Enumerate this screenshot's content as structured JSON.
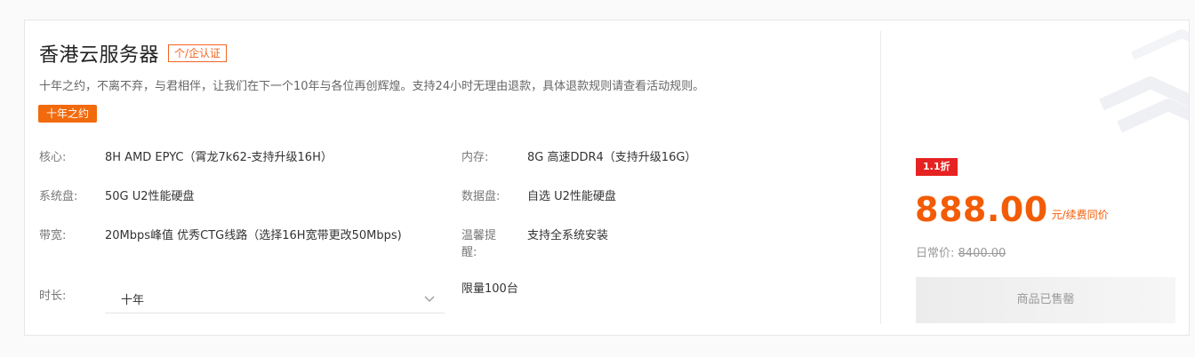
{
  "product": {
    "title": "香港云服务器",
    "auth_tag": "个/企认证",
    "description": "十年之约，不离不弃，与君相伴，让我们在下一个10年与各位再创辉煌。支持24小时无理由退款，具体退款规则请查看活动规则。",
    "promo_tag": "十年之约"
  },
  "specs": {
    "cpu": {
      "label": "核心:",
      "value": "8H AMD EPYC（霄龙7k62-支持升级16H）"
    },
    "memory": {
      "label": "内存:",
      "value": "8G 高速DDR4（支持升级16G）"
    },
    "system_disk": {
      "label": "系统盘:",
      "value": "50G U2性能硬盘"
    },
    "data_disk": {
      "label": "数据盘:",
      "value": "自选 U2性能硬盘"
    },
    "bandwidth": {
      "label": "带宽:",
      "value": "20Mbps峰值 优秀CTG线路（选择16H宽带更改50Mbps)"
    },
    "notice": {
      "label_line1": "温馨提",
      "label_line2": "醒:",
      "value": "支持全系统安装"
    },
    "duration": {
      "label": "时长:",
      "selected": "十年",
      "icon": "chevron-down-icon"
    },
    "limit": "限量100台"
  },
  "pricing": {
    "discount_badge": "1.1折",
    "price": "888.00",
    "price_unit": "元/续费同价",
    "original_label": "日常价:",
    "original_price": "8400.00",
    "sold_out_label": "商品已售罄"
  },
  "colors": {
    "accent": "#f26522",
    "price": "#f25c05",
    "badge_red": "#e62222"
  }
}
